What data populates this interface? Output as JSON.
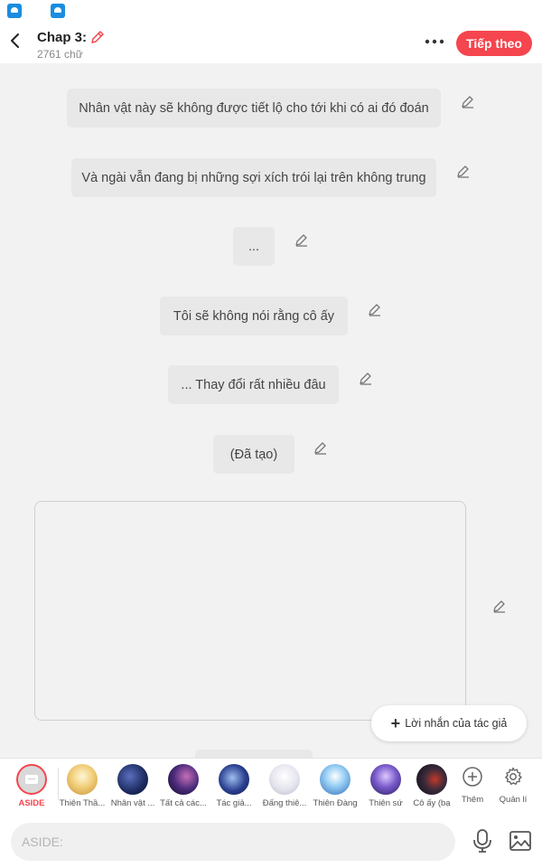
{
  "status_bar": {
    "icons": [
      "app-icon",
      "app-icon"
    ]
  },
  "header": {
    "title": "Chap 3:",
    "word_count": "2761 chữ",
    "next_label": "Tiếp theo",
    "accent": "#f5454e"
  },
  "messages": [
    "Nhân vật này sẽ không được tiết lộ cho tới khi có ai đó đoán",
    "Và ngài vẫn đang bị những sợi xích trói lại trên không trung",
    "...",
    "Tôi sẽ không nói rằng cô ấy",
    "... Thay đổi rất nhiều đâu",
    "(Đã tạo)"
  ],
  "author_button": {
    "label": "Lời nhắn của tác giả"
  },
  "characters": [
    {
      "label": "ASIDE",
      "selected": true
    },
    {
      "label": "Thiên Thầ...",
      "color": "#e8b84a"
    },
    {
      "label": "Nhân vật ...",
      "color": "#1b2a5e"
    },
    {
      "label": "Tất cả các...",
      "color": "#2b1a4a"
    },
    {
      "label": "Tác giả...",
      "color": "#2a3f8f"
    },
    {
      "label": "Đấng thiê...",
      "color": "#d8d8e6"
    },
    {
      "label": "Thiên Đàng",
      "color": "#4b8fd6"
    },
    {
      "label": "Thiên sứ",
      "color": "#6a4fb8"
    },
    {
      "label": "Cô ấy (bạ",
      "color": "#1a1a22"
    }
  ],
  "tools": {
    "more_label": "Thêm",
    "manage_label": "Quản lí"
  },
  "input": {
    "placeholder": "ASIDE:"
  }
}
